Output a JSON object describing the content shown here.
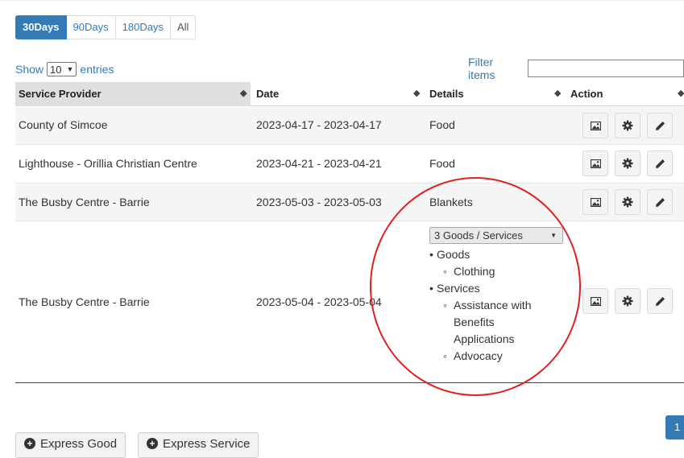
{
  "tabs": [
    {
      "label": "30Days",
      "active": true
    },
    {
      "label": "90Days",
      "active": false
    },
    {
      "label": "180Days",
      "active": false
    },
    {
      "label": "All",
      "active": false
    }
  ],
  "length": {
    "show": "Show",
    "value": "10",
    "entries": "entries"
  },
  "filter": {
    "label": "Filter items",
    "value": ""
  },
  "columns": [
    "Service Provider",
    "Date",
    "Details",
    "Action"
  ],
  "rows": [
    {
      "provider": "County of Simcoe",
      "date": "2023-04-17 - 2023-04-17",
      "details": "Food"
    },
    {
      "provider": "Lighthouse - Orillia Christian Centre",
      "date": "2023-04-21 - 2023-04-21",
      "details": "Food"
    },
    {
      "provider": "The Busby Centre - Barrie",
      "date": "2023-05-03 - 2023-05-03",
      "details": "Blankets"
    },
    {
      "provider": "The Busby Centre - Barrie",
      "date": "2023-05-04 - 2023-05-04",
      "dropdown": "3 Goods / Services",
      "groups": {
        "goods_label": "Goods",
        "goods_items": [
          "Clothing"
        ],
        "services_label": "Services",
        "services_items": [
          "Assistance with",
          "Benefits",
          "Applications",
          "Advocacy"
        ]
      }
    }
  ],
  "action_icons": [
    "image-icon",
    "gear-icon",
    "pencil-icon"
  ],
  "pagination": {
    "current": "1"
  },
  "buttons": {
    "express_good": "Express Good",
    "express_service": "Express Service"
  },
  "colors": {
    "accent": "#337ab7",
    "annotation": "#e02020"
  }
}
